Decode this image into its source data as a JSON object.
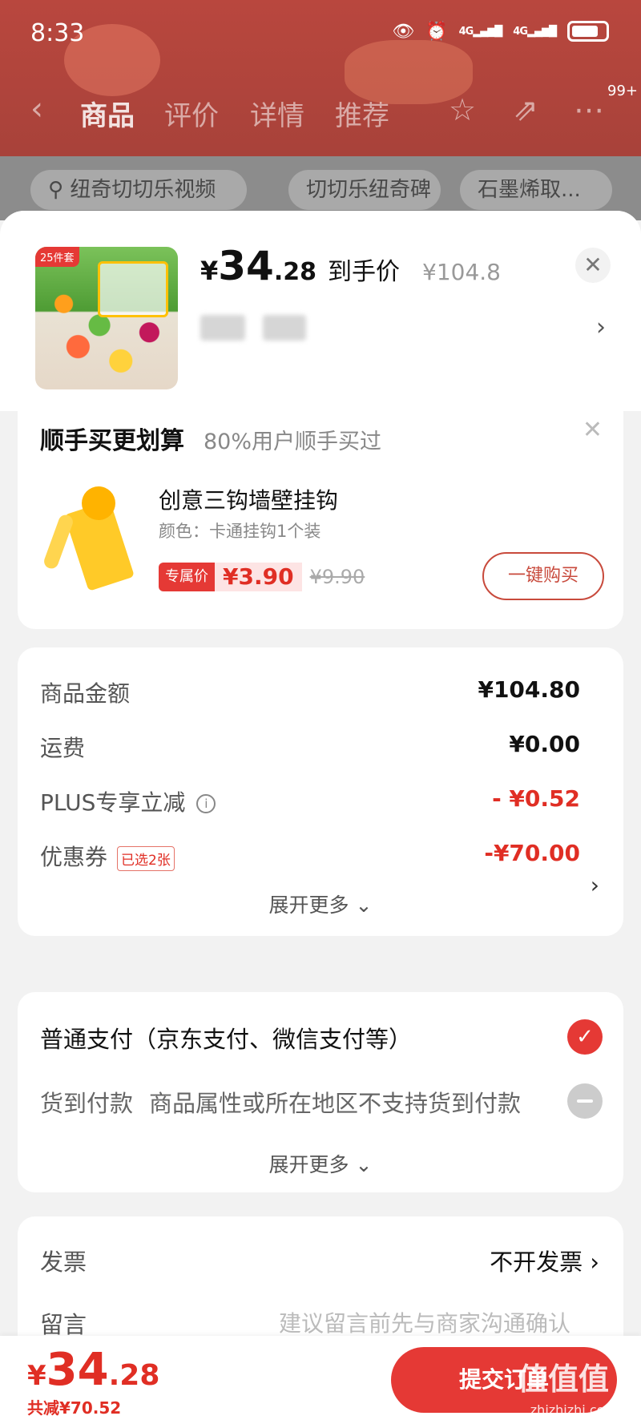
{
  "status_bar": {
    "time": "8:33",
    "signal1": "4G",
    "signal2": "4G"
  },
  "nav": {
    "tabs": [
      "商品",
      "评价",
      "详情",
      "推荐"
    ],
    "badge": "99+"
  },
  "search": {
    "items": [
      "纽奇切切乐视频",
      "切切乐纽奇碑",
      "石墨烯取..."
    ]
  },
  "product": {
    "yen": "¥",
    "price_int": "34",
    "price_dec": ".28",
    "price_label": "到手价",
    "original_price": "¥104.8",
    "thumb_tag": "25件套"
  },
  "addon": {
    "title": "顺手买更划算",
    "subtitle": "80%用户顺手买过",
    "name": "创意三钩墙壁挂钩",
    "spec": "颜色：卡通挂钩1个装",
    "tag": "专属价",
    "price": "¥3.90",
    "original_price": "¥9.90",
    "button": "一键购买"
  },
  "amounts": {
    "rows": [
      {
        "label": "商品金额",
        "value": "¥104.80"
      },
      {
        "label": "运费",
        "value": "¥0.00"
      },
      {
        "label": "PLUS专享立减",
        "value": "- ¥0.52"
      },
      {
        "label": "优惠券",
        "value": "-¥70.00",
        "chip": "已选2张"
      }
    ],
    "more": "展开更多"
  },
  "payment": {
    "option1": "普通支付（京东支付、微信支付等）",
    "option2_label": "货到付款",
    "option2_note": "商品属性或所在地区不支持货到付款",
    "more": "展开更多"
  },
  "invoice": {
    "label": "发票",
    "value": "不开发票",
    "message_label": "留言",
    "message_placeholder": "建议留言前先与商家沟通确认"
  },
  "bottom": {
    "yen": "¥",
    "total_int": "34",
    "total_dec": ".28",
    "saved": "共减¥70.52",
    "submit": "提交订单",
    "watermark": "值值值",
    "watermark_url": "zhizhizhi.com"
  },
  "colors": {
    "accent": "#e53935",
    "price_red": "#e02e24"
  }
}
